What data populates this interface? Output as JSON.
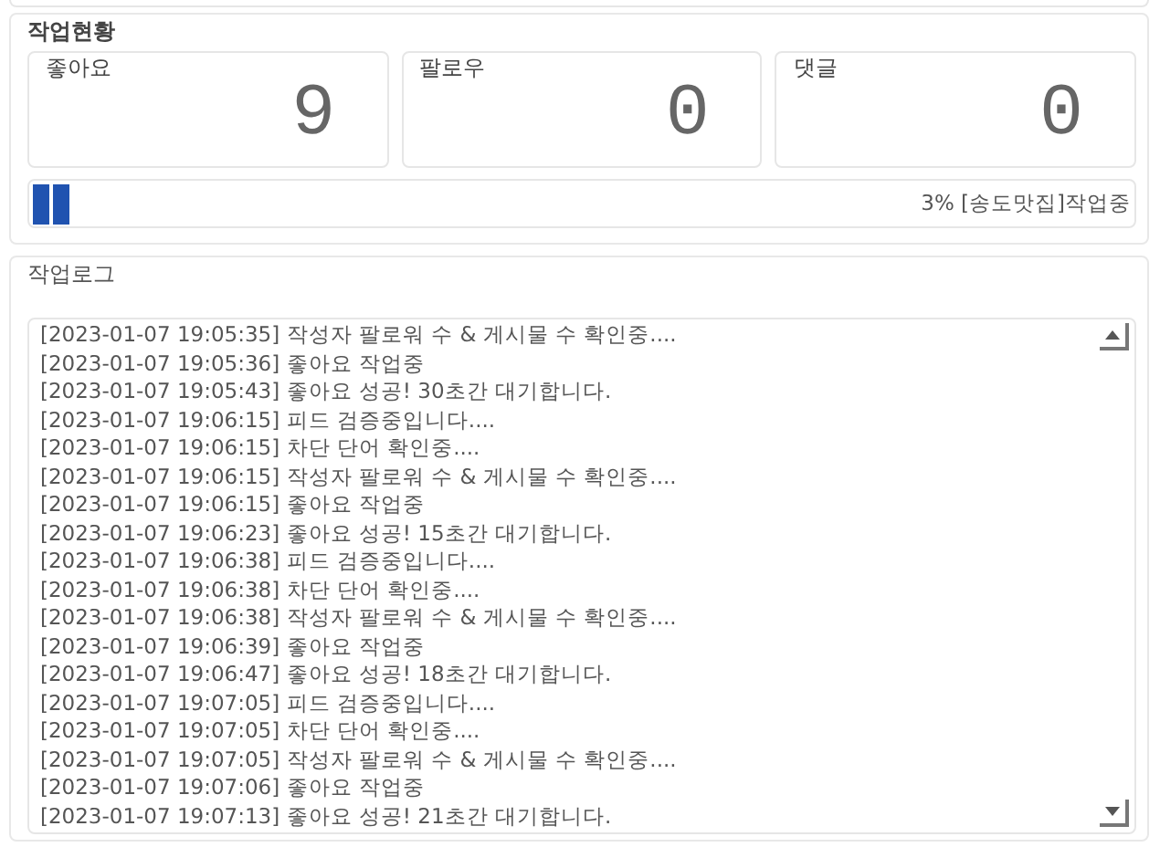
{
  "status": {
    "title": "작업현황",
    "counters": [
      {
        "label": "좋아요",
        "value": "9"
      },
      {
        "label": "팔로우",
        "value": "0"
      },
      {
        "label": "댓글",
        "value": "0"
      }
    ],
    "progress": {
      "level": 0.03,
      "text": "3% [송도맛집]작업중"
    }
  },
  "log": {
    "title": "작업로그",
    "lines": [
      "[2023-01-07 19:05:35] 작성자 팔로워 수 & 게시물 수 확인중....",
      "[2023-01-07 19:05:36] 좋아요 작업중",
      "[2023-01-07 19:05:43] 좋아요 성공! 30초간 대기합니다.",
      "[2023-01-07 19:06:15] 피드 검증중입니다....",
      "[2023-01-07 19:06:15] 차단 단어 확인중....",
      "[2023-01-07 19:06:15] 작성자 팔로워 수 & 게시물 수 확인중....",
      "[2023-01-07 19:06:15] 좋아요 작업중",
      "[2023-01-07 19:06:23] 좋아요 성공! 15초간 대기합니다.",
      "[2023-01-07 19:06:38] 피드 검증중입니다....",
      "[2023-01-07 19:06:38] 차단 단어 확인중....",
      "[2023-01-07 19:06:38] 작성자 팔로워 수 & 게시물 수 확인중....",
      "[2023-01-07 19:06:39] 좋아요 작업중",
      "[2023-01-07 19:06:47] 좋아요 성공! 18초간 대기합니다.",
      "[2023-01-07 19:07:05] 피드 검증중입니다....",
      "[2023-01-07 19:07:05] 차단 단어 확인중....",
      "[2023-01-07 19:07:05] 작성자 팔로워 수 & 게시물 수 확인중....",
      "[2023-01-07 19:07:06] 좋아요 작업중",
      "[2023-01-07 19:07:13] 좋아요 성공! 21초간 대기합니다."
    ]
  }
}
